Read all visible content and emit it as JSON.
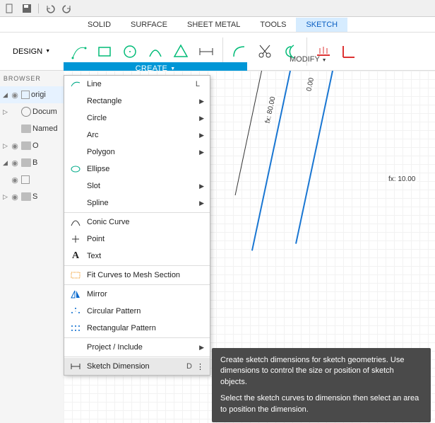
{
  "quickbar": {
    "items": [
      "file",
      "save",
      "undo",
      "redo"
    ]
  },
  "ribbon": {
    "tabs": [
      "SOLID",
      "SURFACE",
      "SHEET METAL",
      "TOOLS",
      "SKETCH"
    ],
    "active": "SKETCH"
  },
  "design_button": "DESIGN",
  "create_label": "CREATE",
  "modify_label": "MODIFY",
  "browser_label": "BROWSER",
  "tree": {
    "items": [
      {
        "label": "origi",
        "highlight": true
      },
      {
        "label": "Docum"
      },
      {
        "label": "Named"
      },
      {
        "label": "O"
      },
      {
        "label": "B"
      },
      {
        "label": ""
      },
      {
        "label": "S"
      }
    ]
  },
  "dropdown": {
    "items": [
      {
        "icon": "line",
        "label": "Line",
        "shortcut": "L"
      },
      {
        "noicon": true,
        "label": "Rectangle",
        "sub": true
      },
      {
        "noicon": true,
        "label": "Circle",
        "sub": true
      },
      {
        "noicon": true,
        "label": "Arc",
        "sub": true
      },
      {
        "noicon": true,
        "label": "Polygon",
        "sub": true
      },
      {
        "icon": "ellipse",
        "label": "Ellipse"
      },
      {
        "noicon": true,
        "label": "Slot",
        "sub": true
      },
      {
        "noicon": true,
        "label": "Spline",
        "sub": true
      },
      {
        "sep": true
      },
      {
        "icon": "conic",
        "label": "Conic Curve"
      },
      {
        "icon": "point",
        "label": "Point"
      },
      {
        "icon": "text",
        "label": "Text"
      },
      {
        "sep": true
      },
      {
        "icon": "fit",
        "label": "Fit Curves to Mesh Section"
      },
      {
        "sep": true
      },
      {
        "icon": "mirror",
        "label": "Mirror"
      },
      {
        "icon": "circ",
        "label": "Circular Pattern"
      },
      {
        "icon": "rect",
        "label": "Rectangular Pattern"
      },
      {
        "sep": true
      },
      {
        "noicon": true,
        "label": "Project / Include",
        "sub": true
      },
      {
        "sep": true
      },
      {
        "icon": "dim",
        "label": "Sketch Dimension",
        "shortcut": "D",
        "hover": true,
        "more": true
      }
    ]
  },
  "dimensions": {
    "d1": "fx: 80.00",
    "d2": "0.00",
    "d3": "fx: 10.00"
  },
  "tooltip": {
    "p1": "Create sketch dimensions for sketch geometries. Use dimensions to control the size or position of sketch objects.",
    "p2": "Select the sketch curves to dimension then select an area to position the dimension."
  }
}
